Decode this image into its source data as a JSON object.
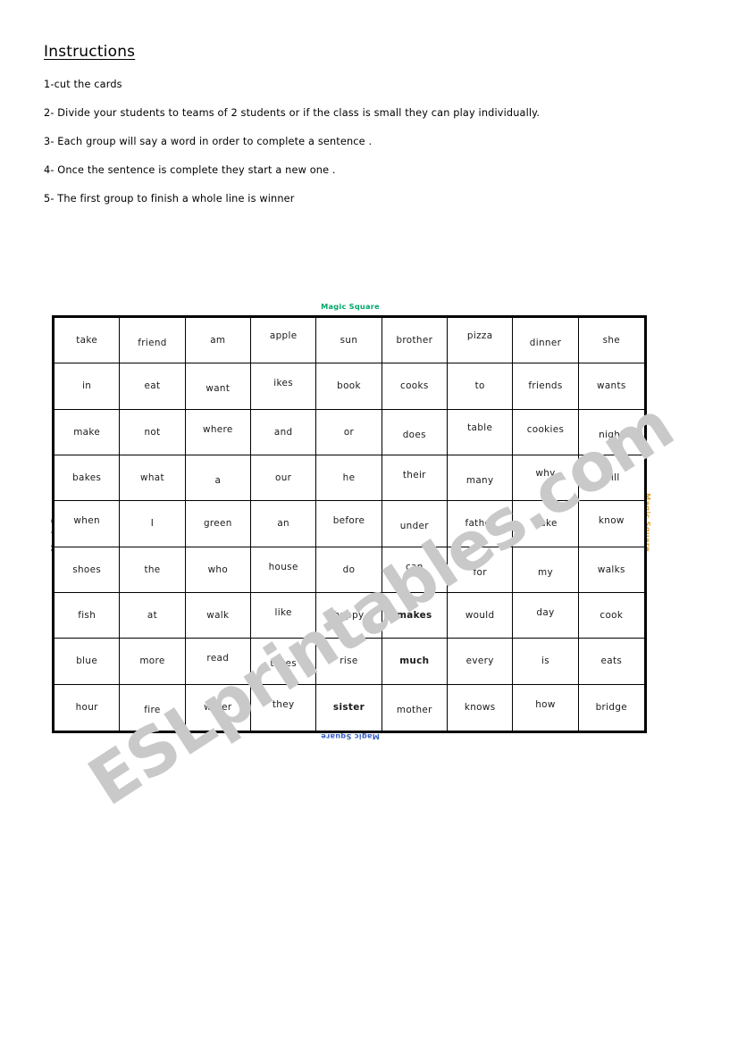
{
  "document": {
    "instructions_title": "Instructions",
    "instructions": [
      "1-cut the cards",
      "2- Divide your students to teams of  2 students or if the class is small they can play individually.",
      "3- Each group will say a word in order to complete a sentence .",
      "4- Once the sentence is complete they start a new one .",
      "5- The first group to finish a whole line is winner"
    ]
  },
  "watermark": {
    "text": "ESLprintables.com",
    "color": "#c9c9c9"
  },
  "board": {
    "captions": {
      "top": "Magic Square",
      "bottom": "Magic Square",
      "left": "Magic Square",
      "right": "Magic Square"
    },
    "caption_colors": {
      "top": "#00a86b",
      "bottom": "#3b60c4",
      "left": "#cc44bb",
      "right": "#e0a01e"
    },
    "rows": 9,
    "columns": 9,
    "cells": [
      [
        "take",
        "friend",
        "am",
        "apple",
        "sun",
        "brother",
        "pizza",
        "dinner",
        "she"
      ],
      [
        "in",
        "eat",
        "want",
        "ikes",
        "book",
        "cooks",
        "to",
        "friends",
        "wants"
      ],
      [
        "make",
        "not",
        "where",
        "and",
        "or",
        "does",
        "table",
        "cookies",
        "night"
      ],
      [
        "bakes",
        "what",
        "a",
        "our",
        "he",
        "their",
        "many",
        "why",
        "will"
      ],
      [
        "when",
        "I",
        "green",
        "an",
        "before",
        "under",
        "father",
        "bake",
        "know"
      ],
      [
        "shoes",
        "the",
        "who",
        "house",
        "do",
        "can",
        "for",
        "my",
        "walks"
      ],
      [
        "fish",
        "at",
        "walk",
        "like",
        "happy",
        "makes",
        "would",
        "day",
        "cook"
      ],
      [
        "blue",
        "more",
        "read",
        "takes",
        "rise",
        "much",
        "every",
        "is",
        "eats"
      ],
      [
        "hour",
        "fire",
        "water",
        "they",
        "sister",
        "mother",
        "knows",
        "how",
        "bridge"
      ]
    ]
  }
}
